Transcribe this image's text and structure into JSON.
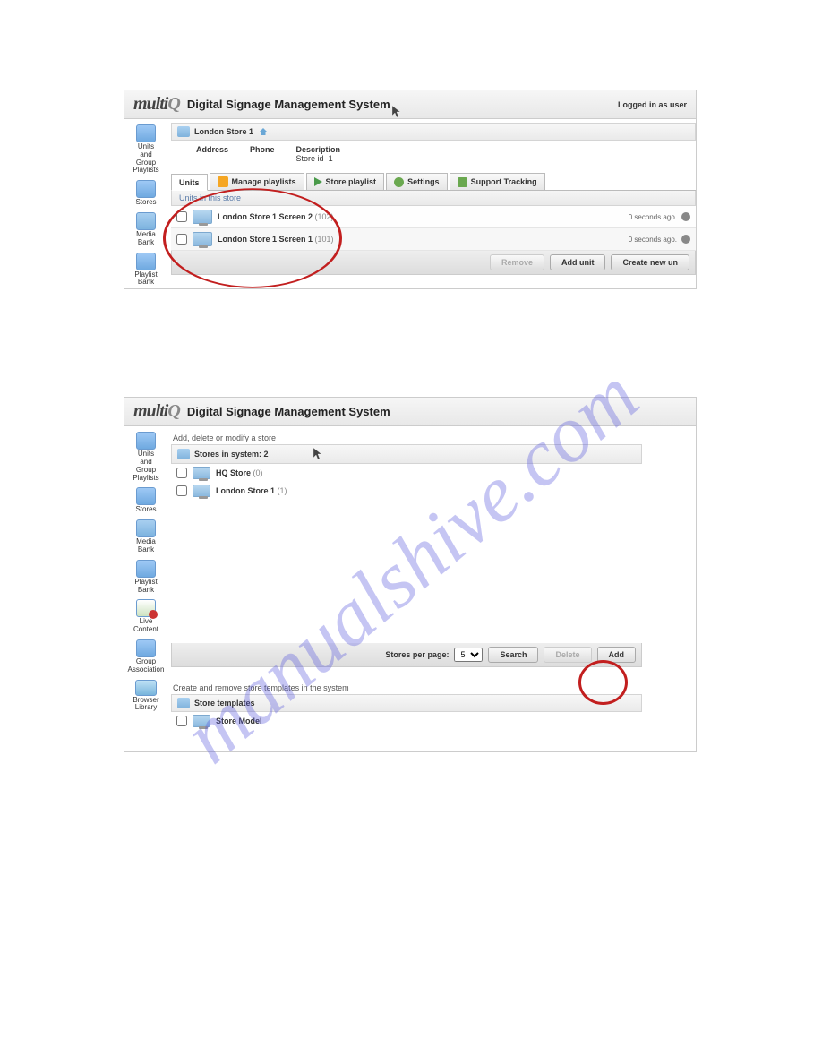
{
  "watermark": "manualshive.com",
  "header": {
    "logo": "multiQ",
    "title": "Digital Signage Management System",
    "right": "Logged in as user"
  },
  "sidebar": {
    "items": [
      {
        "key": "units",
        "label": "Units\nand\nGroup\nPlaylists"
      },
      {
        "key": "stores",
        "label": "Stores"
      },
      {
        "key": "media",
        "label": "Media\nBank"
      },
      {
        "key": "playlist",
        "label": "Playlist\nBank"
      },
      {
        "key": "live",
        "label": "Live\nContent"
      },
      {
        "key": "group-assoc",
        "label": "Group\nAssociation"
      },
      {
        "key": "browser",
        "label": "Browser\nLibrary"
      }
    ]
  },
  "panel1": {
    "breadcrumb": "London Store 1",
    "info": {
      "address_lbl": "Address",
      "phone_lbl": "Phone",
      "desc_lbl": "Description",
      "storeid_lbl": "Store id",
      "storeid_val": "1"
    },
    "tabs": [
      {
        "key": "units",
        "label": "Units",
        "active": true
      },
      {
        "key": "manage",
        "label": "Manage playlists",
        "active": false
      },
      {
        "key": "storepl",
        "label": "Store playlist",
        "active": false
      },
      {
        "key": "settings",
        "label": "Settings",
        "active": false
      },
      {
        "key": "support",
        "label": "Support Tracking",
        "active": false
      }
    ],
    "section_label": "Units in this store",
    "units": [
      {
        "name": "London Store 1 Screen 2",
        "id": "(102)",
        "time": "0 seconds ago."
      },
      {
        "name": "London Store 1 Screen 1",
        "id": "(101)",
        "time": "0 seconds ago."
      }
    ],
    "buttons": {
      "remove": "Remove",
      "add_unit": "Add unit",
      "create_new_un": "Create new un"
    }
  },
  "panel2": {
    "desc1": "Add, delete or modify a store",
    "stores_hdr": "Stores in system: 2",
    "stores": [
      {
        "name": "HQ Store",
        "count": "(0)"
      },
      {
        "name": "London Store 1",
        "count": "(1)"
      }
    ],
    "ctrl": {
      "spp_lbl": "Stores per page:",
      "spp_val": "5",
      "search": "Search",
      "delete": "Delete",
      "add": "Add"
    },
    "desc2": "Create and remove store templates in the system",
    "templates_hdr": "Store templates",
    "templates": [
      {
        "name": "Store Model"
      }
    ]
  }
}
